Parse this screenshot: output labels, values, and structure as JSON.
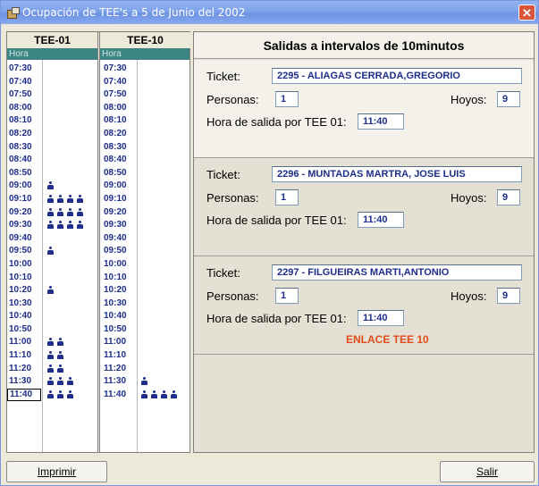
{
  "window": {
    "title": "Ocupación de TEE's a 5 de Junio del 2002",
    "close_label": "✕"
  },
  "schedule": {
    "col1_header": "TEE-01",
    "col2_header": "TEE-10",
    "sub_label": "Hora",
    "times": [
      "07:30",
      "07:40",
      "07:50",
      "08:00",
      "08:10",
      "08:20",
      "08:30",
      "08:40",
      "08:50",
      "09:00",
      "09:10",
      "09:20",
      "09:30",
      "09:40",
      "09:50",
      "10:00",
      "10:10",
      "10:20",
      "10:30",
      "10:40",
      "10:50",
      "11:00",
      "11:10",
      "11:20",
      "11:30",
      "11:40"
    ],
    "tee01_people": [
      0,
      0,
      0,
      0,
      0,
      0,
      0,
      0,
      0,
      1,
      4,
      4,
      4,
      0,
      1,
      0,
      0,
      1,
      0,
      0,
      0,
      2,
      2,
      2,
      3,
      3
    ],
    "tee10_people": [
      0,
      0,
      0,
      0,
      0,
      0,
      0,
      0,
      0,
      0,
      0,
      0,
      0,
      0,
      0,
      0,
      0,
      0,
      0,
      0,
      0,
      0,
      0,
      0,
      1,
      4
    ],
    "selected_time": "11:40"
  },
  "panel": {
    "header": "Salidas a intervalos de 10minutos",
    "labels": {
      "ticket": "Ticket:",
      "personas": "Personas:",
      "hoyos": "Hoyos:",
      "salida": "Hora de salida por TEE 01:"
    },
    "entries": [
      {
        "ticket": "2295 - ALIAGAS CERRADA,GREGORIO",
        "personas": "1",
        "hoyos": "9",
        "salida": "11:40",
        "note": ""
      },
      {
        "ticket": "2296 - MUNTADAS MARTRA, JOSE LUIS",
        "personas": "1",
        "hoyos": "9",
        "salida": "11:40",
        "note": ""
      },
      {
        "ticket": "2297 - FILGUEIRAS MARTI,ANTONIO",
        "personas": "1",
        "hoyos": "9",
        "salida": "11:40",
        "note": "ENLACE TEE 10"
      }
    ]
  },
  "buttons": {
    "print": "Imprimir",
    "exit": "Salir"
  },
  "colors": {
    "accent": "#1e2e8a",
    "hora_band": "#3c8583",
    "warning": "#e24b1c"
  }
}
